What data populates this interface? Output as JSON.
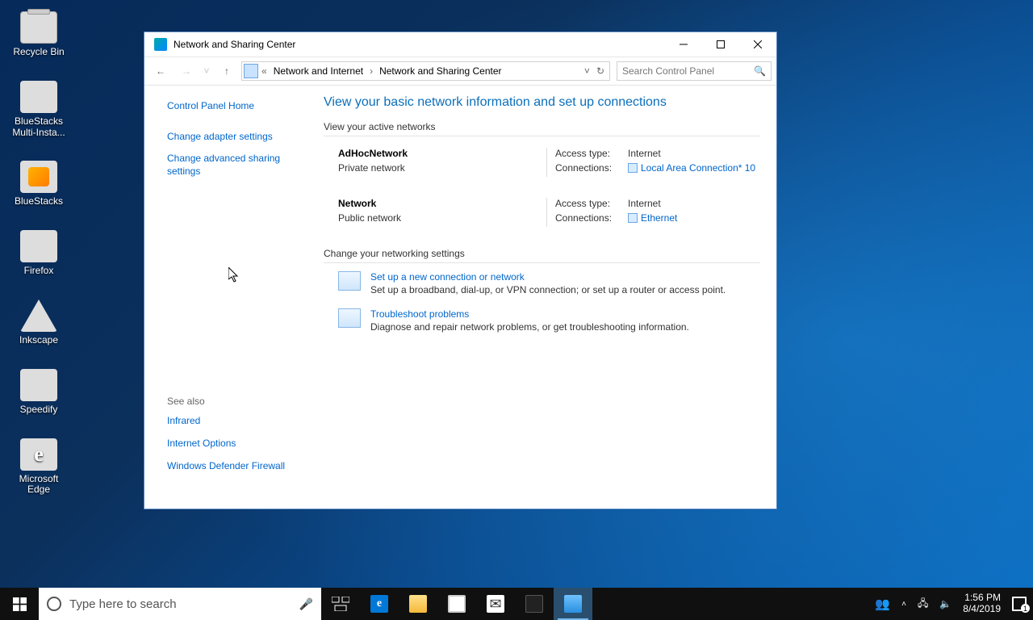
{
  "desktop": {
    "icons": [
      {
        "label": "Recycle Bin"
      },
      {
        "label": "BlueStacks Multi-Insta..."
      },
      {
        "label": "BlueStacks"
      },
      {
        "label": "Firefox"
      },
      {
        "label": "Inkscape"
      },
      {
        "label": "Speedify"
      },
      {
        "label": "Microsoft Edge"
      }
    ]
  },
  "window": {
    "title": "Network and Sharing Center",
    "breadcrumb": {
      "chev_label": "«",
      "segment1": "Network and Internet",
      "segment2": "Network and Sharing Center"
    },
    "search_placeholder": "Search Control Panel",
    "sidebar": {
      "home": "Control Panel Home",
      "adapter": "Change adapter settings",
      "advanced": "Change advanced sharing settings",
      "seealso_hdr": "See also",
      "infrared": "Infrared",
      "internet_options": "Internet Options",
      "firewall": "Windows Defender Firewall"
    },
    "main": {
      "heading": "View your basic network information and set up connections",
      "active_hdr": "View your active networks",
      "net1": {
        "name": "AdHocNetwork",
        "type": "Private network",
        "access_label": "Access type:",
        "access_value": "Internet",
        "conn_label": "Connections:",
        "conn_value": "Local Area Connection* 10"
      },
      "net2": {
        "name": "Network",
        "type": "Public network",
        "access_label": "Access type:",
        "access_value": "Internet",
        "conn_label": "Connections:",
        "conn_value": "Ethernet"
      },
      "change_hdr": "Change your networking settings",
      "action1": {
        "title": "Set up a new connection or network",
        "desc": "Set up a broadband, dial-up, or VPN connection; or set up a router or access point."
      },
      "action2": {
        "title": "Troubleshoot problems",
        "desc": "Diagnose and repair network problems, or get troubleshooting information."
      }
    }
  },
  "taskbar": {
    "search_placeholder": "Type here to search",
    "time": "1:56 PM",
    "date": "8/4/2019"
  }
}
